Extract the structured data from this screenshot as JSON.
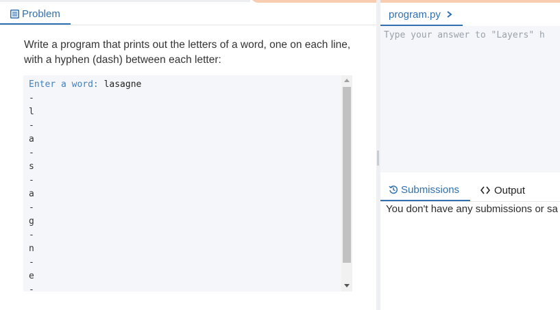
{
  "problem_tab": {
    "label": "Problem",
    "icon": "document-icon"
  },
  "problem": {
    "text": "Write a program that prints out the letters of a word, one on each line, with a hyphen (dash) between each letter:"
  },
  "console": {
    "prompt": "Enter a word: ",
    "input": "lasagne",
    "lines": [
      "-",
      "l",
      "-",
      "a",
      "-",
      "s",
      "-",
      "a",
      "-",
      "g",
      "-",
      "n",
      "-",
      "e",
      "-"
    ]
  },
  "editor_tab": {
    "label": "program.py",
    "icon": "chevron-right-icon"
  },
  "editor": {
    "placeholder": "Type your answer to \"Layers\" h"
  },
  "bottom_tabs": {
    "submissions_label": "Submissions",
    "submissions_icon": "history-icon",
    "output_label": "Output",
    "output_icon": "code-icon"
  },
  "submissions": {
    "message": "You don't have any submissions or sa"
  },
  "colors": {
    "accent": "#2f6fb0",
    "prompt": "#3f7fbf",
    "console_bg": "#f4f6f9",
    "top_accent": "#f8cdb0"
  }
}
